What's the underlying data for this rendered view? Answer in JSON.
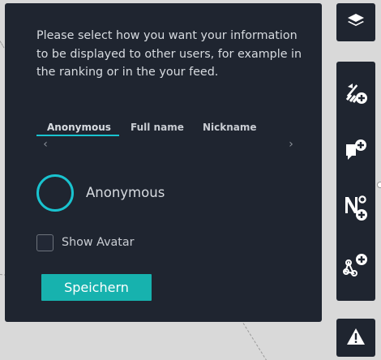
{
  "panel": {
    "intro_text": "Please select how you want your information to be displayed to other users, for example in the ranking or in the your feed.",
    "tabs": [
      {
        "label": "Anonymous",
        "active": true
      },
      {
        "label": "Full name",
        "active": false
      },
      {
        "label": "Nickname",
        "active": false
      }
    ],
    "prev_arrow": "‹",
    "next_arrow": "›",
    "selected_name": "Anonymous",
    "show_avatar_label": "Show Avatar",
    "show_avatar_checked": false,
    "save_label": "Speichern"
  },
  "toolbar": {
    "items": [
      {
        "icon": "layers-icon"
      },
      {
        "icon": "add-route-icon"
      },
      {
        "icon": "add-comment-icon"
      },
      {
        "icon": "add-number-icon"
      },
      {
        "icon": "add-node-icon"
      },
      {
        "icon": "warning-icon"
      }
    ],
    "number_glyph": "N°"
  },
  "colors": {
    "panel_bg": "#1f2530",
    "accent": "#19c3cf",
    "button_bg": "#17b2ae",
    "map_bg": "#d9d9d9"
  }
}
